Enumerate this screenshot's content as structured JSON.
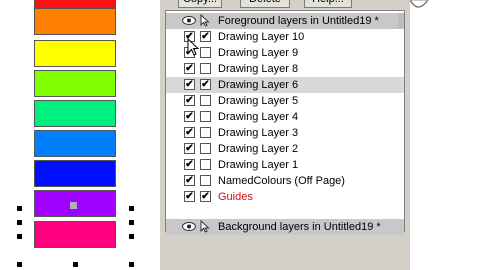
{
  "swatches": {
    "colors": [
      "#ff1010",
      "#ff8000",
      "#ffff00",
      "#80ff00",
      "#00f080",
      "#0080ff",
      "#0010ff",
      "#a000ff",
      "#ff0080"
    ]
  },
  "toolbar": {
    "copy_label": "Copy...",
    "delete_label": "Delete",
    "help_label": "Help..."
  },
  "layers": {
    "foreground_header": "Foreground layers in Untitled19 *",
    "background_header": "Background layers in Untitled19 *",
    "items": [
      {
        "label": "Drawing Layer 10",
        "visible": true,
        "locked": true
      },
      {
        "label": "Drawing Layer 9",
        "visible": true,
        "locked": false
      },
      {
        "label": "Drawing Layer 8",
        "visible": true,
        "locked": false
      },
      {
        "label": "Drawing Layer 6",
        "visible": true,
        "locked": true
      },
      {
        "label": "Drawing Layer 5",
        "visible": true,
        "locked": false
      },
      {
        "label": "Drawing Layer 4",
        "visible": true,
        "locked": false
      },
      {
        "label": "Drawing Layer 3",
        "visible": true,
        "locked": false
      },
      {
        "label": "Drawing Layer 2",
        "visible": true,
        "locked": false
      },
      {
        "label": "Drawing Layer 1",
        "visible": true,
        "locked": false
      },
      {
        "label": "NamedColours (Off Page)",
        "visible": true,
        "locked": false
      },
      {
        "label": "Guides",
        "visible": true,
        "locked": true
      }
    ],
    "selected_index": 3,
    "guides_color": "#d01010"
  },
  "icons": {
    "visibility": "eye-icon",
    "pointer": "pointer-icon",
    "check": "✔"
  }
}
